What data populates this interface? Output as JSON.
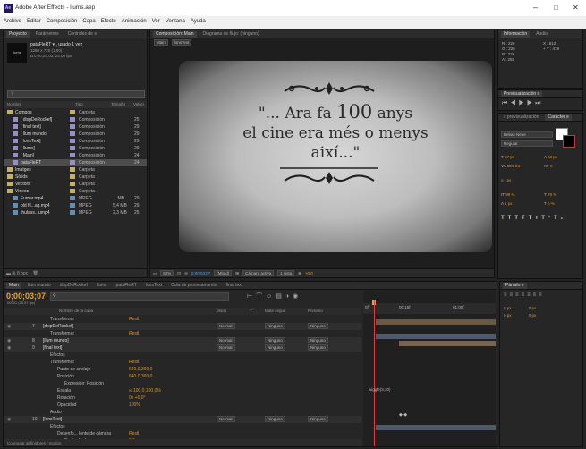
{
  "app": {
    "title": "Adobe After Effects - llums.aep",
    "window_controls": [
      "–",
      "□",
      "✕"
    ]
  },
  "menu": [
    "Archivo",
    "Editar",
    "Composición",
    "Capa",
    "Efecto",
    "Animación",
    "Ver",
    "Ventana",
    "Ayuda"
  ],
  "project": {
    "tabs": [
      "Proyecto",
      "Parámetros",
      "Controles de ≡"
    ],
    "thumb_text": "llums",
    "item_name": "pataFleRT ▾ , usado 1 vez",
    "item_line1": "1280 x 720 (1,00)",
    "item_line2": "Δ 0;00;20;03, 24,00 fps",
    "search_placeholder": "",
    "cols": [
      "Nombre",
      "Tipo",
      "Tamaño",
      "Veloci"
    ],
    "items": [
      {
        "name": "Compos",
        "type": "Carpeta",
        "size": "",
        "speed": "",
        "color": "#c7b15d",
        "icon": "folder"
      },
      {
        "name": "[ dispDeRockef]",
        "type": "Composición",
        "size": "",
        "speed": "25",
        "color": "#9a8ad0",
        "icon": "comp"
      },
      {
        "name": "[ final text]",
        "type": "Composición",
        "size": "",
        "speed": "29",
        "color": "#9a8ad0",
        "icon": "comp"
      },
      {
        "name": "[ llum mundo]",
        "type": "Composición",
        "size": "",
        "speed": "29",
        "color": "#9a8ad0",
        "icon": "comp"
      },
      {
        "name": "[ lonsText]",
        "type": "Composición",
        "size": "",
        "speed": "29",
        "color": "#9a8ad0",
        "icon": "comp"
      },
      {
        "name": "[ llums]",
        "type": "Composición",
        "size": "",
        "speed": "29",
        "color": "#9a8ad0",
        "icon": "comp"
      },
      {
        "name": "[ Main]",
        "type": "Composición",
        "size": "",
        "speed": "24",
        "color": "#9a8ad0",
        "icon": "comp"
      },
      {
        "name": "pataFleRT",
        "type": "Composición",
        "size": "",
        "speed": "24",
        "color": "#9a8ad0",
        "icon": "comp",
        "selected": true
      },
      {
        "name": "Imatges",
        "type": "Carpeta",
        "size": "",
        "speed": "",
        "color": "#c7b15d",
        "icon": "folder"
      },
      {
        "name": "Sòlids",
        "type": "Carpeta",
        "size": "",
        "speed": "",
        "color": "#c7b15d",
        "icon": "folder"
      },
      {
        "name": "Vectors",
        "type": "Carpeta",
        "size": "",
        "speed": "",
        "color": "#c7b15d",
        "icon": "folder"
      },
      {
        "name": "Videos",
        "type": "Carpeta",
        "size": "",
        "speed": "",
        "color": "#c7b15d",
        "icon": "folder"
      },
      {
        "name": "Fumar.mp4",
        "type": "MPEG",
        "size": "... MB",
        "speed": "29",
        "color": "#5a8fbf",
        "icon": "footage"
      },
      {
        "name": "old fil...ag.mp4",
        "type": "MPEG",
        "size": "5,4 MB",
        "speed": "29",
        "color": "#5a8fbf",
        "icon": "footage"
      },
      {
        "name": "thulass...ump4",
        "type": "MPEG",
        "size": "2,3 MB",
        "speed": "25",
        "color": "#5a8fbf",
        "icon": "footage"
      }
    ],
    "footer": "8 bpc"
  },
  "composition": {
    "tabs": [
      "Composición: Main",
      "Diagrama de flujo: (ninguno)"
    ],
    "subtabs": [
      "Main",
      "lonsText"
    ],
    "text_line1_pre": "\"... Ara fa ",
    "text_line1_num": "100",
    "text_line1_post": " anys",
    "text_line2": "el cine era més o menys",
    "text_line3": "així...\"",
    "zoom": "50%",
    "timecode": "0;00;03;07",
    "resolution": "(Mitad)",
    "camera": "Cámara activa",
    "views": "1 vista",
    "exposure": "+0,0"
  },
  "info": {
    "tabs": [
      "Información",
      "Audio"
    ],
    "r": "R : 226",
    "g": "G : 226",
    "b": "B : 226",
    "a": "A : 255",
    "x": "X : 612",
    "y": "+ Y : 478"
  },
  "preview": {
    "tab": "Previsualización ≡"
  },
  "character": {
    "tabs": [
      "s previsualización",
      "Carácter ≡"
    ],
    "font": "Bebas Neue",
    "style": "Regular",
    "size": "67 px",
    "leading": "53 px",
    "kerning": "Métrico",
    "tracking": "0",
    "stroke": "- px",
    "stroke_type": "",
    "vscale": "99 %",
    "hscale": "79 %",
    "baseline": "1 px",
    "tsume": "0 %"
  },
  "paragraph": {
    "tab": "Párrafo ≡",
    "v1": "0 px",
    "v2": "0 px",
    "v3": "0 px",
    "v4": "0 px",
    "v5": "0 px"
  },
  "timeline": {
    "tabs": [
      "Main",
      "llum mundo",
      "dispDeRockef",
      "llums",
      "pataFleRT",
      "lonsText",
      "Cola de procesamiento",
      "final text"
    ],
    "timecode": "0;00;03;07",
    "frames": "00091 (29,97 fps)",
    "col_headers": [
      "Nombre de la capa",
      "Modo",
      "T",
      "Mate seguir",
      "Primario"
    ],
    "ruler": [
      "0f",
      "00:15f",
      "01:00f"
    ],
    "layers": [
      {
        "num": "",
        "name": "Transformar",
        "mode": "",
        "mate": "",
        "parent": "",
        "value": "Restl.",
        "indent": 1,
        "kind": "group"
      },
      {
        "num": "7",
        "name": "[dispDeRockef]",
        "mode": "Normal",
        "mate": "Ninguno",
        "parent": "Ninguno",
        "value": "",
        "indent": 0,
        "kind": "layer"
      },
      {
        "num": "",
        "name": "Transformar",
        "mode": "",
        "mate": "",
        "parent": "",
        "value": "Restl.",
        "indent": 1,
        "kind": "group"
      },
      {
        "num": "8",
        "name": "[llum mundo]",
        "mode": "Normal",
        "mate": "Ninguno",
        "parent": "Ninguno",
        "value": "",
        "indent": 0,
        "kind": "layer"
      },
      {
        "num": "9",
        "name": "[final text]",
        "mode": "Normal",
        "mate": "Ninguno",
        "parent": "Ninguno",
        "value": "",
        "indent": 0,
        "kind": "layer"
      },
      {
        "num": "",
        "name": "Efectos",
        "mode": "",
        "mate": "",
        "parent": "",
        "value": "",
        "indent": 1,
        "kind": "group"
      },
      {
        "num": "",
        "name": "Transformar",
        "mode": "",
        "mate": "",
        "parent": "",
        "value": "Restl.",
        "indent": 1,
        "kind": "group"
      },
      {
        "num": "",
        "name": "Punto de anclaje",
        "mode": "",
        "mate": "",
        "parent": "",
        "value": "640,0,360,0",
        "indent": 2,
        "kind": "prop"
      },
      {
        "num": "",
        "name": "Posición",
        "mode": "",
        "mate": "",
        "parent": "",
        "value": "640,0,360,0",
        "indent": 2,
        "kind": "prop"
      },
      {
        "num": "",
        "name": "Expresión: Posición",
        "mode": "",
        "mate": "",
        "parent": "",
        "value": "",
        "indent": 3,
        "kind": "prop"
      },
      {
        "num": "",
        "name": "Escala",
        "mode": "",
        "mate": "",
        "parent": "",
        "value": "∞ 100,0,100,0%",
        "indent": 2,
        "kind": "prop"
      },
      {
        "num": "",
        "name": "Rotación",
        "mode": "",
        "mate": "",
        "parent": "",
        "value": "0x +0,0°",
        "indent": 2,
        "kind": "prop"
      },
      {
        "num": "",
        "name": "Opacidad",
        "mode": "",
        "mate": "",
        "parent": "",
        "value": "100%",
        "indent": 2,
        "kind": "prop"
      },
      {
        "num": "",
        "name": "Audio",
        "mode": "",
        "mate": "",
        "parent": "",
        "value": "",
        "indent": 1,
        "kind": "group"
      },
      {
        "num": "10",
        "name": "[lonsText]",
        "mode": "Normal",
        "mate": "Ninguno",
        "parent": "Ninguno",
        "value": "",
        "indent": 0,
        "kind": "layer"
      },
      {
        "num": "",
        "name": "Efectos",
        "mode": "",
        "mate": "",
        "parent": "",
        "value": "",
        "indent": 1,
        "kind": "group"
      },
      {
        "num": "",
        "name": "Desenfo... lente de cámara",
        "mode": "",
        "mate": "",
        "parent": "",
        "value": "Restl.",
        "indent": 2,
        "kind": "prop"
      },
      {
        "num": "",
        "name": "Radio d... foque",
        "mode": "",
        "mate": "",
        "parent": "",
        "value": "0,0",
        "indent": 3,
        "kind": "prop"
      }
    ],
    "expression_text": "wiggle(3,30)",
    "extra_value": "Anula de...",
    "footer_toggle": "Conmutar definidores / modos"
  },
  "colors": {
    "accent": "#2d8ceb",
    "orange": "#d8962e",
    "playhead": "#e23b3b"
  }
}
